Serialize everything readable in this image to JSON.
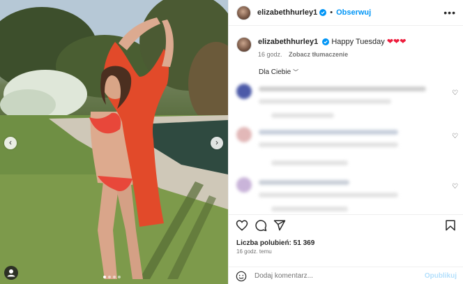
{
  "post": {
    "username": "elizabethhurley1",
    "separator": "•",
    "follow_label": "Obserwuj",
    "more_icon": "more-horizontal-icon",
    "caption_text": "Happy Tuesday",
    "caption_hearts": "❤❤❤",
    "caption_time": "16 godz.",
    "translate_label": "Zobacz tłumaczenie",
    "comment_filter": "Dla Ciebie",
    "likes_label": "Liczba polubień:",
    "likes_count": "51 369",
    "post_time": "16 godz. temu",
    "comment_placeholder": "Dodaj komentarz...",
    "publish_label": "Opublikuj"
  },
  "carousel": {
    "slide_count": 4,
    "active_slide": 1
  },
  "colors": {
    "accent": "#0095f6",
    "publish_disabled": "#b2dffc",
    "heart_red": "#ed1c3c",
    "bikini": "#e8473a"
  }
}
